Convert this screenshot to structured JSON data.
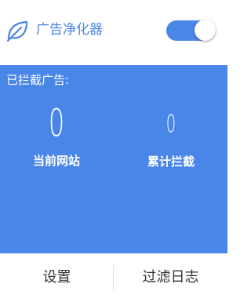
{
  "header": {
    "title": "广告净化器",
    "logo_icon": "leaf-icon",
    "toggle_state": "on"
  },
  "stats": {
    "heading": "已拦截广告:",
    "current_site": {
      "value": "0",
      "label": "当前网站"
    },
    "total": {
      "value": "0",
      "label": "累计拦截"
    }
  },
  "footer": {
    "settings_label": "设置",
    "log_label": "过滤日志"
  },
  "colors": {
    "accent": "#4a86e8",
    "panel_text": "#ffffff",
    "footer_text": "#333333"
  }
}
